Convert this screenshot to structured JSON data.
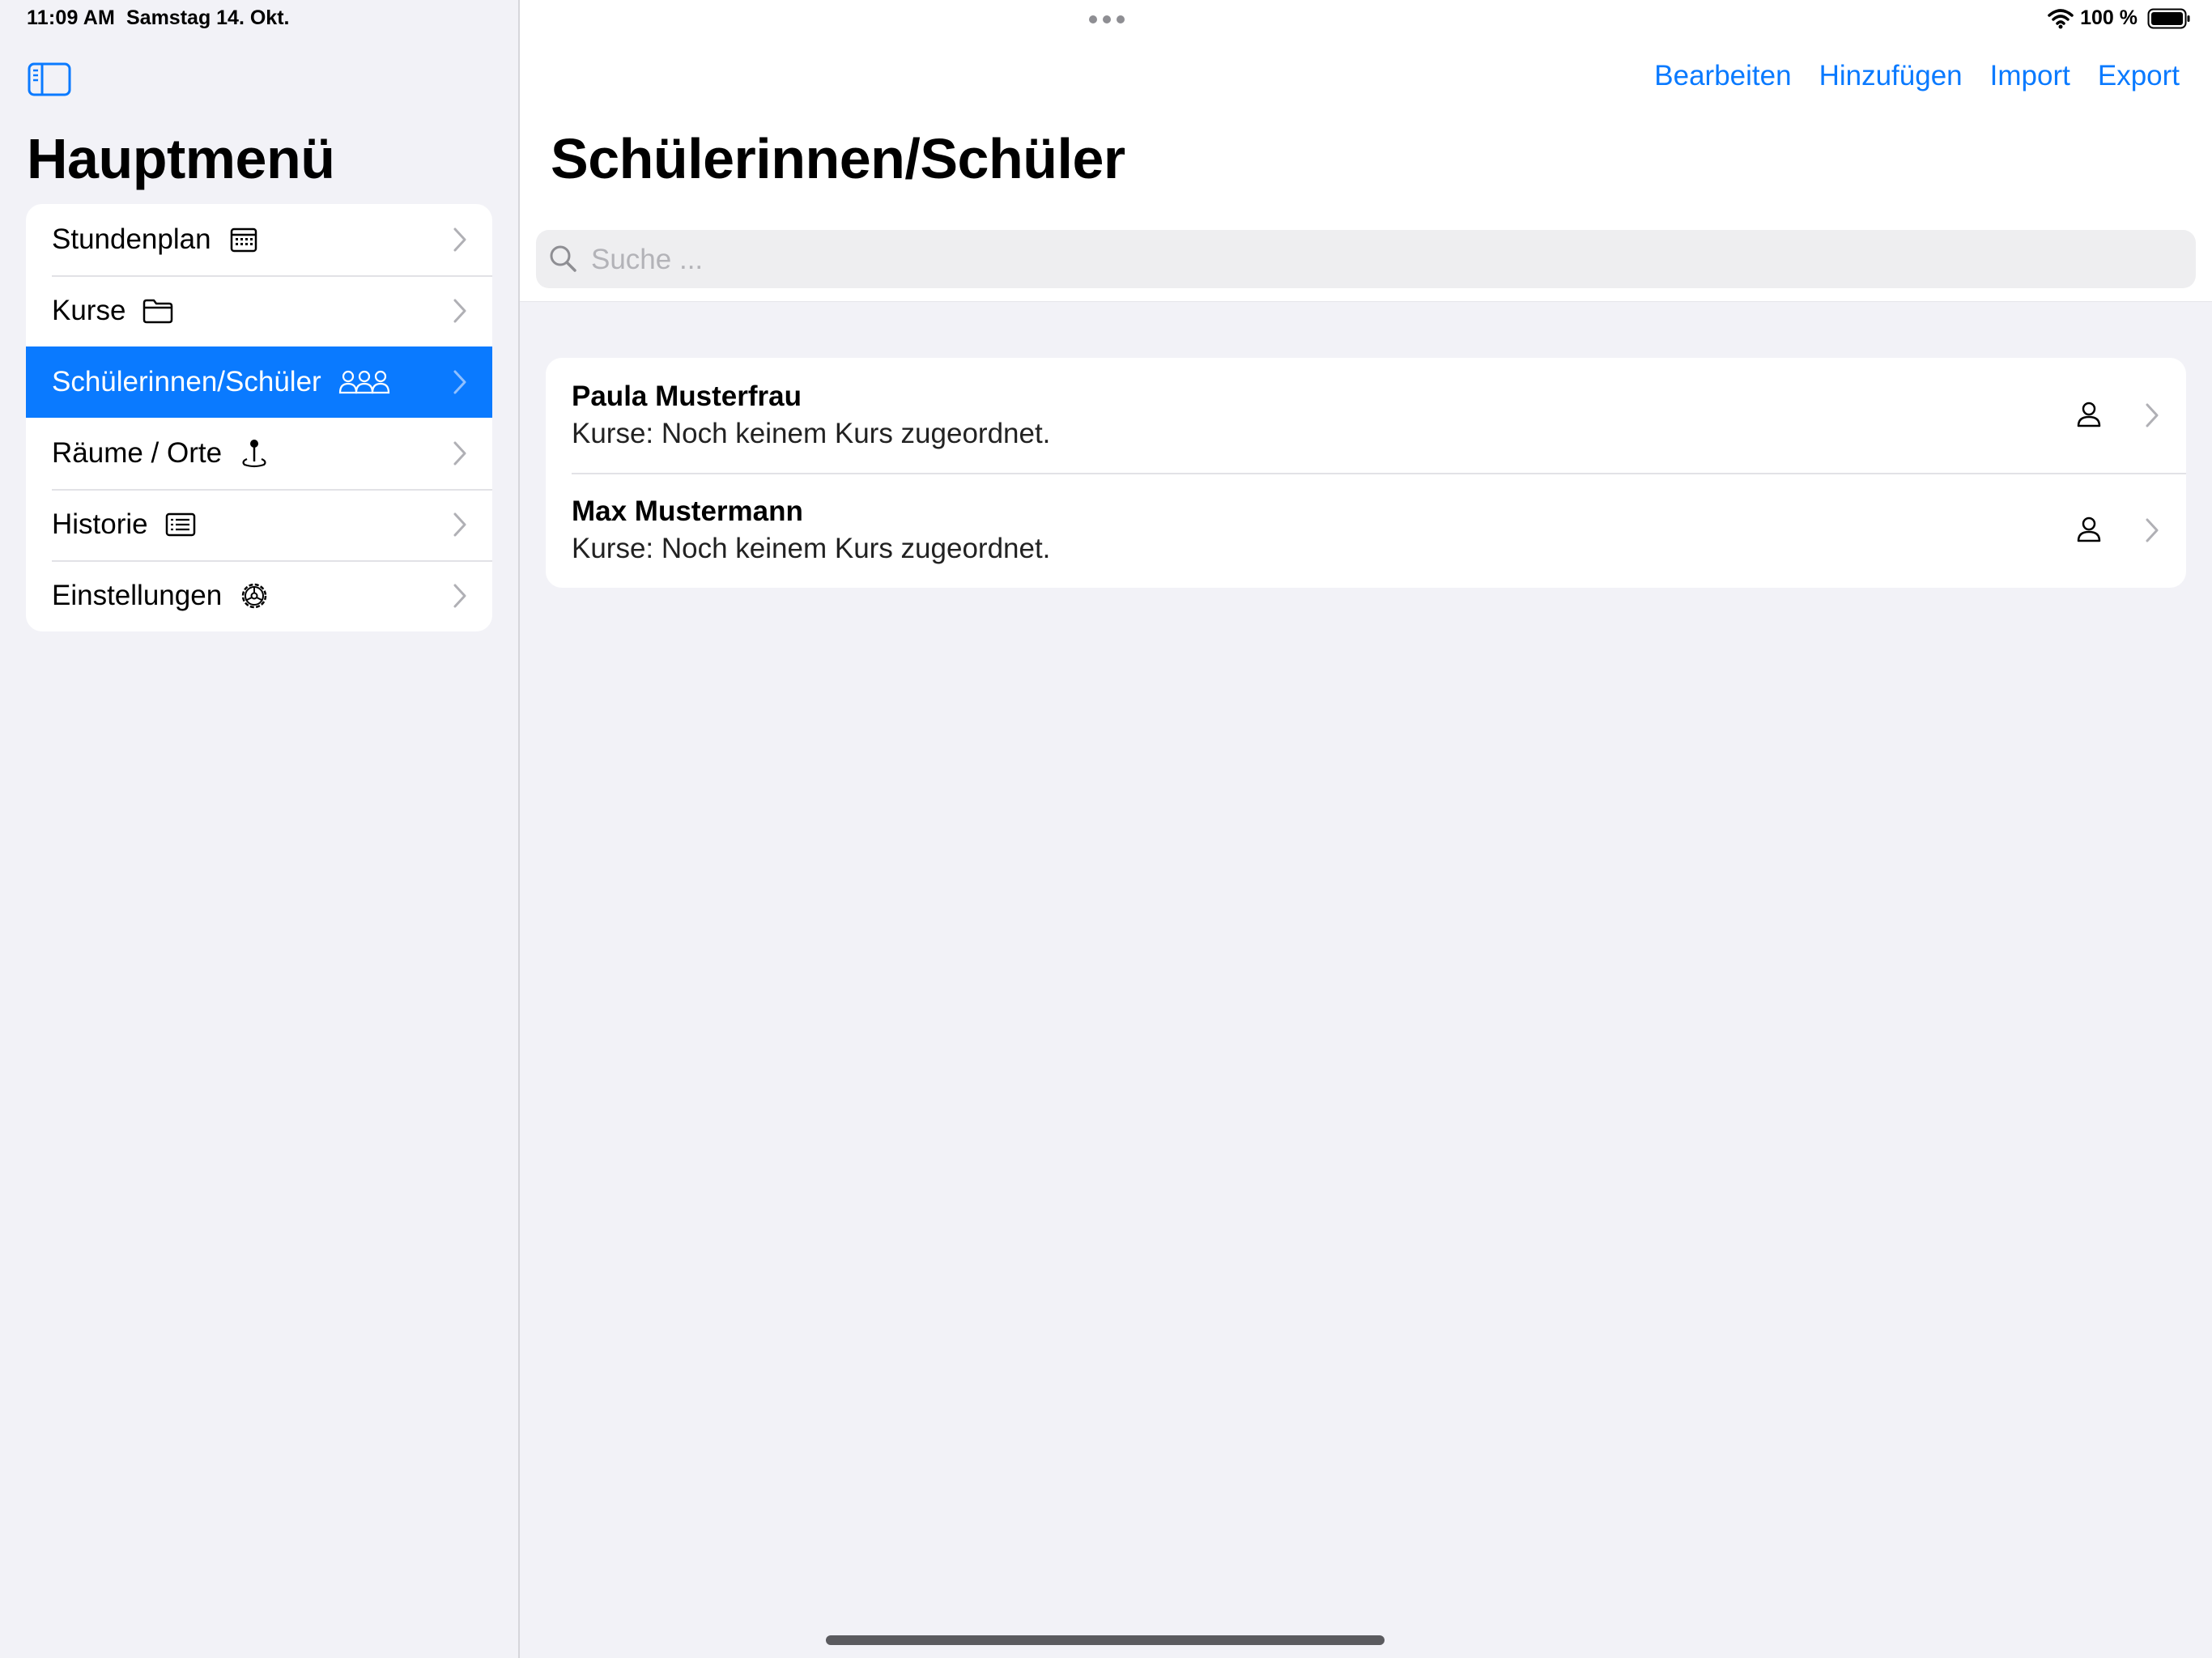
{
  "status": {
    "time": "11:09 AM",
    "date": "Samstag 14. Okt.",
    "battery": "100 %"
  },
  "sidebar": {
    "title": "Hauptmenü",
    "items": [
      {
        "label": "Stundenplan",
        "icon": "calendar-icon"
      },
      {
        "label": "Kurse",
        "icon": "folder-icon"
      },
      {
        "label": "Schülerinnen/Schüler",
        "icon": "people-icon",
        "selected": true
      },
      {
        "label": "Räume / Orte",
        "icon": "location-pin-icon"
      },
      {
        "label": "Historie",
        "icon": "list-document-icon"
      },
      {
        "label": "Einstellungen",
        "icon": "gear-icon"
      }
    ]
  },
  "toolbar": {
    "edit": "Bearbeiten",
    "add": "Hinzufügen",
    "import": "Import",
    "export": "Export"
  },
  "main": {
    "title": "Schülerinnen/Schüler",
    "search_placeholder": "Suche ...",
    "students": [
      {
        "name": "Paula  Musterfrau",
        "courses": "Kurse: Noch keinem Kurs zugeordnet."
      },
      {
        "name": "Max  Mustermann",
        "courses": "Kurse: Noch keinem Kurs zugeordnet."
      }
    ]
  },
  "colors": {
    "accent": "#0a7aff",
    "background": "#f2f2f7",
    "card": "#ffffff"
  }
}
